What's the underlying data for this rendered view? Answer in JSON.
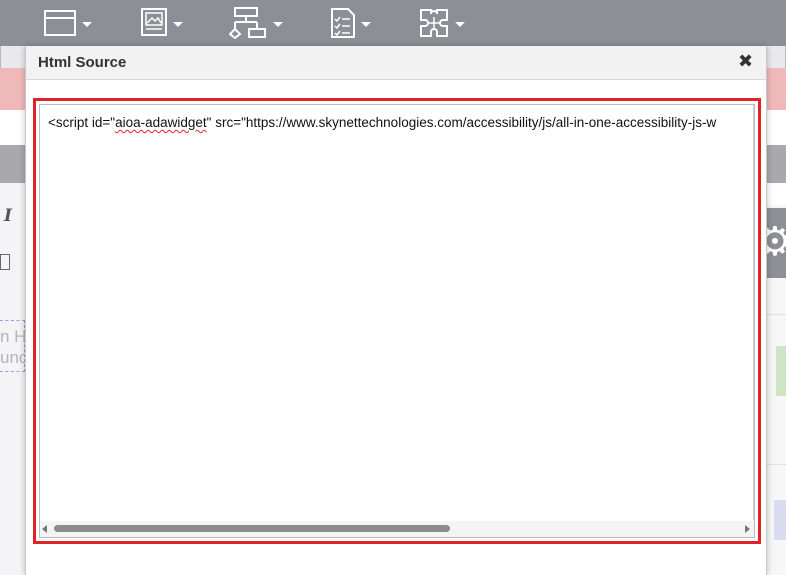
{
  "toolbar": {
    "buttons": [
      {
        "icon": "window-icon"
      },
      {
        "icon": "image-icon"
      },
      {
        "icon": "sitemap-icon"
      },
      {
        "icon": "checklist-icon"
      },
      {
        "icon": "puzzle-icon"
      }
    ]
  },
  "background": {
    "italic_glyph": "I",
    "faded_text_1": "n H",
    "faded_text_2": "und",
    "gear_glyph": "⚙"
  },
  "dialog": {
    "title": "Html Source",
    "close_glyph": "✖",
    "code": {
      "before": "<script id=\"",
      "misspelled": "aioa-adawidget",
      "after": "\" src=\"https://www.skynettechnologies.com/accessibility/js/all-in-one-accessibility-js-w"
    }
  },
  "colors": {
    "toolbar_bg": "#8e8e97",
    "highlight_border": "#e0232a",
    "pink_banner": "#f0b9b9",
    "dialog_header_bg": "#f2f2f3"
  }
}
